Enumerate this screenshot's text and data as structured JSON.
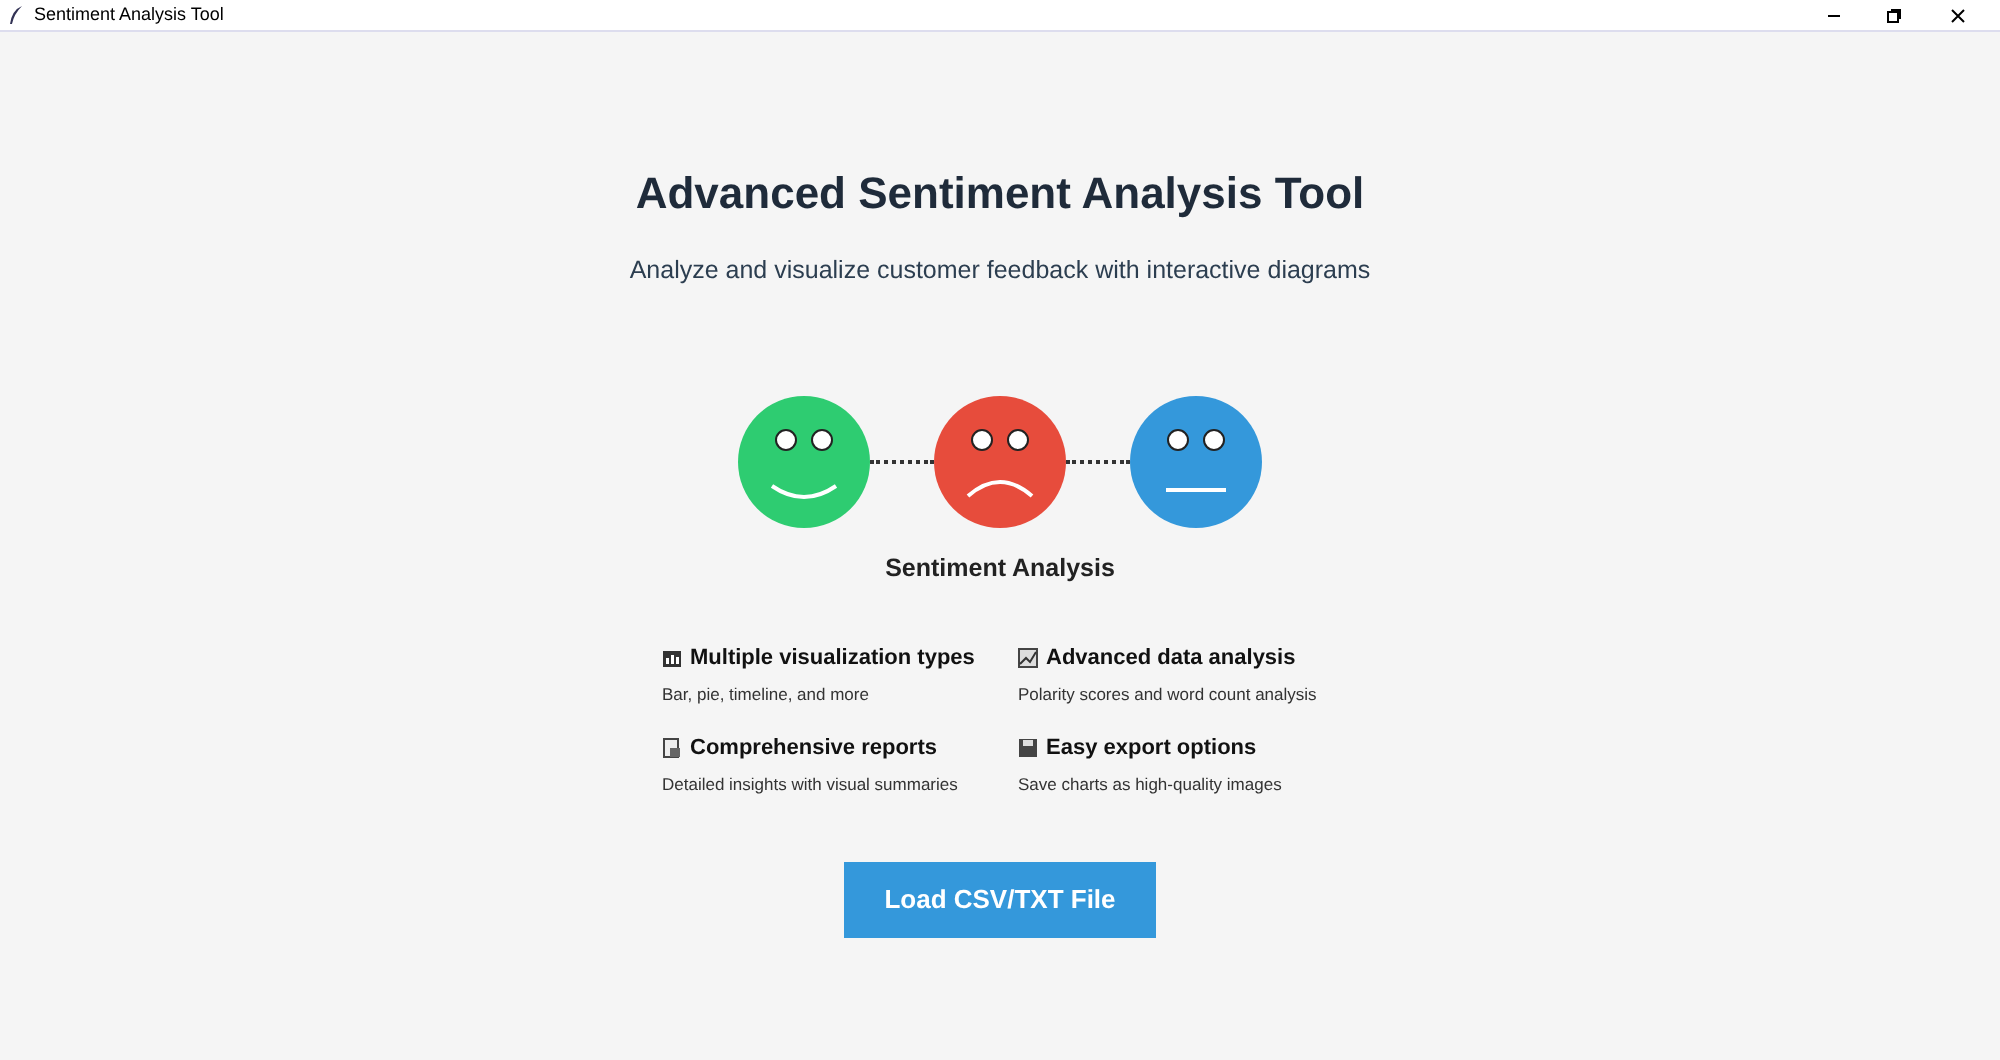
{
  "window": {
    "title": "Sentiment Analysis Tool"
  },
  "heading": "Advanced Sentiment Analysis Tool",
  "subtitle": "Analyze and visualize customer feedback with interactive diagrams",
  "faces": [
    {
      "kind": "happy",
      "color": "#2ecc71"
    },
    {
      "kind": "sad",
      "color": "#e74c3c"
    },
    {
      "kind": "neutral",
      "color": "#3498db"
    }
  ],
  "diagram_label": "Sentiment Analysis",
  "features": [
    {
      "kind": "chart",
      "title": "Multiple visualization types",
      "description": "Bar, pie, timeline, and more"
    },
    {
      "kind": "analysis",
      "title": "Advanced data analysis",
      "description": "Polarity scores and word count analysis"
    },
    {
      "kind": "report",
      "title": "Comprehensive reports",
      "description": "Detailed insights with visual summaries"
    },
    {
      "kind": "export",
      "title": "Easy export options",
      "description": "Save charts as high-quality images"
    }
  ],
  "load_button": "Load CSV/TXT File"
}
